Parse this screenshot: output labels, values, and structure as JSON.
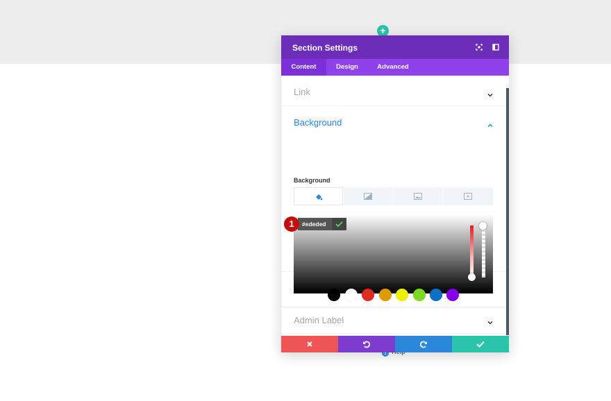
{
  "modal": {
    "title": "Section Settings",
    "tabs": [
      "Content",
      "Design",
      "Advanced"
    ],
    "active_tab": "Content"
  },
  "sections": {
    "link": "Link",
    "background": "Background",
    "admin_label": "Admin Label"
  },
  "background": {
    "field_label": "Background",
    "type_tabs": [
      "color-icon",
      "gradient-icon",
      "image-icon",
      "video-icon"
    ],
    "hex_value": "#ededed",
    "marker": "1",
    "swatches": [
      "#000000",
      "#ffffff",
      "#e02b20",
      "#e09900",
      "#edf000",
      "#7cda24",
      "#0c71c3",
      "#8300e9"
    ]
  },
  "help": {
    "label": "Help"
  },
  "colors": {
    "header": "#6c2eb9",
    "tabs": "#8f42ec",
    "accent": "#2b87da",
    "cancel": "#ef5555",
    "undo": "#7e3bd0",
    "redo": "#2b87da",
    "save": "#29c4a9"
  }
}
